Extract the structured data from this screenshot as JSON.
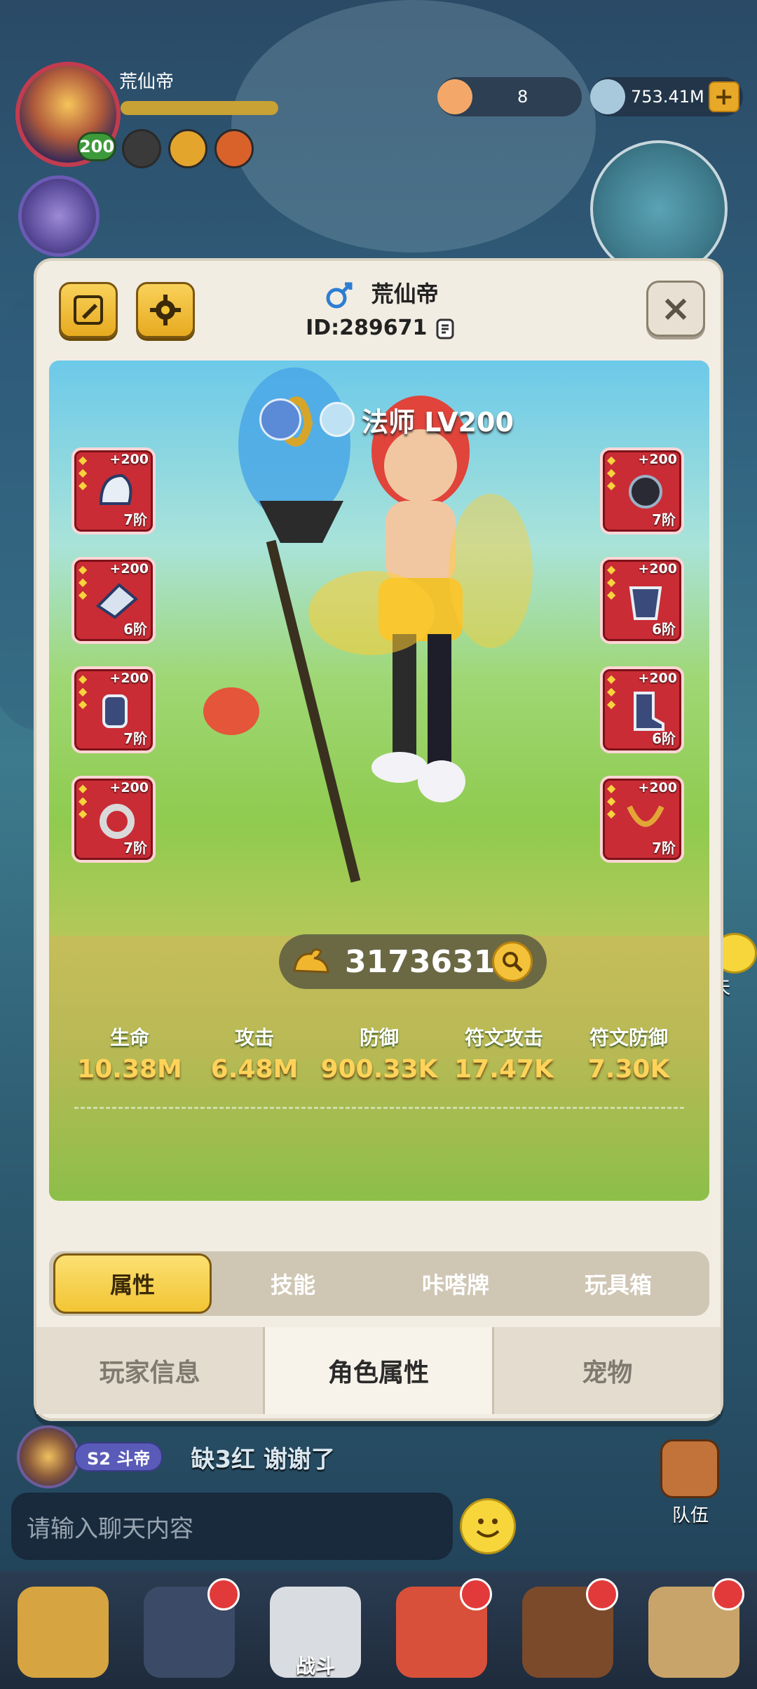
{
  "hud": {
    "player_name": "荒仙帝",
    "level": "200",
    "resource_1_value": "8",
    "resource_2_value": "753.41M",
    "resource_plus": "+"
  },
  "dialog": {
    "player_name": "荒仙帝",
    "player_id": "ID:289671",
    "close_symbol": "×"
  },
  "character": {
    "class_level": "法师 LV200"
  },
  "equipment": {
    "left": [
      {
        "plus": "+200",
        "tier": "7阶"
      },
      {
        "plus": "+200",
        "tier": "6阶"
      },
      {
        "plus": "+200",
        "tier": "7阶"
      },
      {
        "plus": "+200",
        "tier": "7阶"
      }
    ],
    "right": [
      {
        "plus": "+200",
        "tier": "7阶"
      },
      {
        "plus": "+200",
        "tier": "6阶"
      },
      {
        "plus": "+200",
        "tier": "6阶"
      },
      {
        "plus": "+200",
        "tier": "7阶"
      }
    ]
  },
  "power": {
    "value": "31736319"
  },
  "stats": [
    {
      "label": "生命",
      "value": "10.38M"
    },
    {
      "label": "攻击",
      "value": "6.48M"
    },
    {
      "label": "防御",
      "value": "900.33K"
    },
    {
      "label": "符文攻击",
      "value": "17.47K"
    },
    {
      "label": "符文防御",
      "value": "7.30K"
    }
  ],
  "subtabs": [
    "属性",
    "技能",
    "咔嗒牌",
    "玩具箱"
  ],
  "maintabs": [
    "玩家信息",
    "角色属性",
    "宠物"
  ],
  "chat_side": {
    "label": "聊天"
  },
  "chat": {
    "rank": "S2 斗帝",
    "message": "缺3红   谢谢了",
    "placeholder": "请输入聊天内容"
  },
  "team": {
    "label": "队伍"
  },
  "bottom_nav": {
    "battle_label": "战斗"
  },
  "colors": {
    "accent_yellow": "#f2c534",
    "equip_red": "#c92c35",
    "stat_value": "#ffd35a"
  }
}
